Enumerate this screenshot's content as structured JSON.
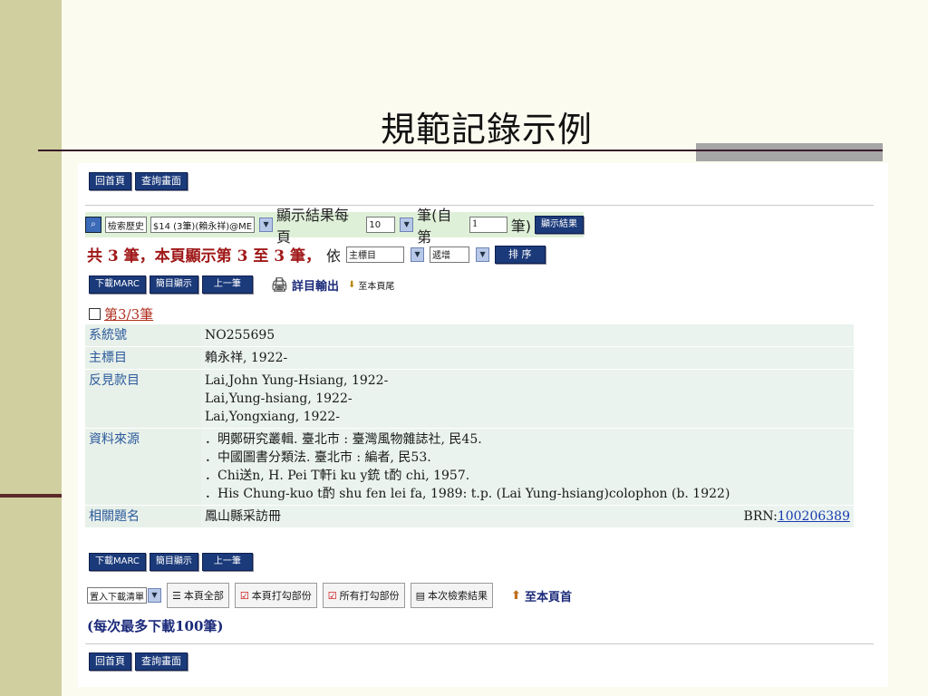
{
  "slide_title": "規範記錄示例",
  "nav": {
    "home_label": "回首頁",
    "query_label": "查詢畫面"
  },
  "search": {
    "history_label": "檢索歷史",
    "query_value": "$14 (3筆)(賴永祥)@ME",
    "per_page_label": "顯示結果每頁",
    "per_page_value": "10",
    "from_label": "筆(自第",
    "from_value": "1",
    "from_suffix": "筆)",
    "show_button": "顯示結果"
  },
  "summary": {
    "text": "共 3 筆，本頁顯示第 3 至 3 筆，",
    "by": "依",
    "sort_field": "主標目",
    "sort_order": "遞增",
    "sort_button": "排 序"
  },
  "toolbar": {
    "download_marc": "下載MARC",
    "brief_display": "簡目顯示",
    "prev": "上一筆",
    "detail_output": "詳目輸出",
    "to_bottom": "至本頁尾"
  },
  "record": {
    "heading": "第3/3筆",
    "rows": [
      {
        "label": "系統號",
        "values": [
          "NO255695"
        ]
      },
      {
        "label": "主標目",
        "values": [
          "賴永祥, 1922-"
        ]
      },
      {
        "label": "反見款目",
        "values": [
          "Lai,John Yung-Hsiang, 1922-",
          "Lai,Yung-hsiang, 1922-",
          "Lai,Yongxiang, 1922-"
        ]
      },
      {
        "label": "資料來源",
        "values": [
          "．明鄭研究叢輯. 臺北市 : 臺灣風物雜誌社, 民45.",
          "．中國圖書分類法. 臺北市 : 編者, 民53.",
          "．Chi送n, H. Pei T軒i ku y銃 t酌 chi, 1957.",
          "．His Chung-kuo t酌 shu fen lei fa, 1989: t.p. (Lai Yung-hsiang)colophon (b. 1922)"
        ]
      },
      {
        "label": "相關題名",
        "values": [
          "鳳山縣采訪冊"
        ]
      }
    ],
    "brn_label": "BRN:",
    "brn_value": "100206389"
  },
  "actions": {
    "basket": "置入下載清單",
    "page_all": "本頁全部",
    "page_checked": "本頁打勾部份",
    "all_checked": "所有打勾部份",
    "session_results": "本次檢索結果",
    "to_top": "至本頁首"
  },
  "note": "(每次最多下載100筆)",
  "colors": {
    "sidebar": "#cfcf9f",
    "button": "#1b3a7a",
    "label": "#2a5a9a",
    "summary": "#a01818"
  }
}
